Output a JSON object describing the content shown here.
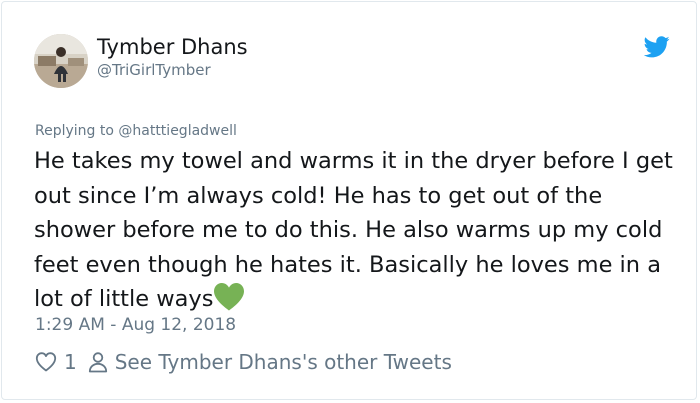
{
  "author": {
    "display_name": "Tymber Dhans",
    "handle": "@TriGirlTymber",
    "avatar_icon": "avatar"
  },
  "platform_icon": "twitter-bird-icon",
  "reply_context": "Replying to @hatttiegladwell",
  "tweet": {
    "text": "He takes my towel and warms it in the dryer before I get out since I’m always cold! He has to get out of the shower before me to do this. He also warms up my cold feet even though he hates it. Basically he loves me in a lot of little ways",
    "emoji": "green-heart-emoji"
  },
  "timestamp": "1:29 AM - Aug 12, 2018",
  "actions": {
    "like_count": "1",
    "other_tweets_label": "See Tymber Dhans's other Tweets"
  },
  "colors": {
    "twitter_blue": "#1da1f2",
    "secondary_text": "#657786",
    "primary_text": "#14171a",
    "emoji_green": "#77b255"
  }
}
